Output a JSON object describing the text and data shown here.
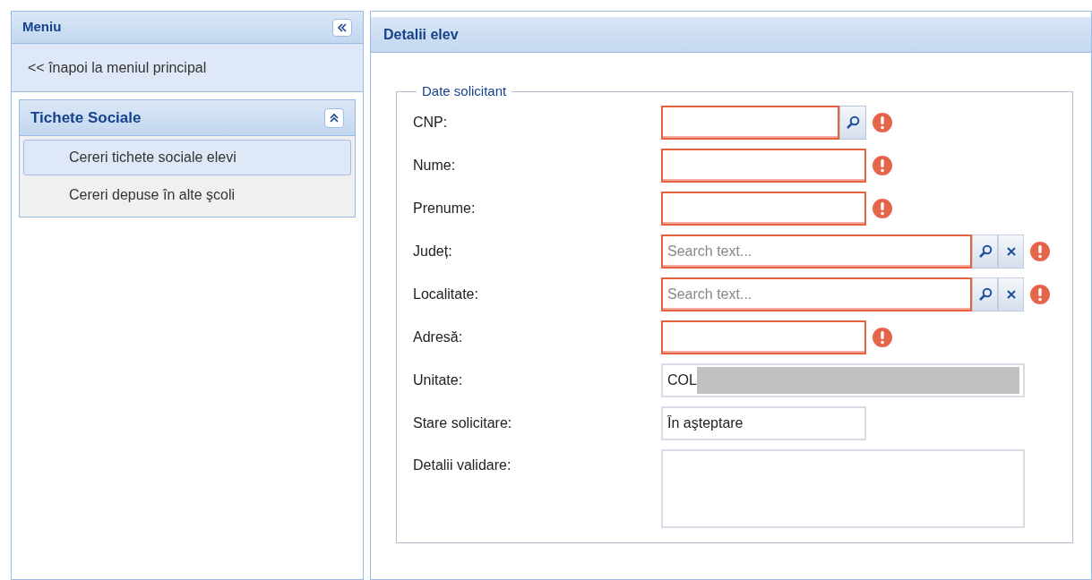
{
  "sidebar": {
    "title": "Meniu",
    "back_link": "<< înapoi la meniul principal",
    "section": {
      "title": "Tichete Sociale",
      "expanded": true,
      "items": [
        {
          "label": "Cereri tichete sociale elevi",
          "selected": true
        },
        {
          "label": "Cereri depuse în alte şcoli",
          "selected": false
        }
      ]
    }
  },
  "main": {
    "title": "Detalii elev",
    "fieldset": {
      "legend": "Date solicitant",
      "fields": [
        {
          "label": "CNP:",
          "kind": "lookup",
          "invalid": true
        },
        {
          "label": "Nume:",
          "kind": "text",
          "invalid": true
        },
        {
          "label": "Prenume:",
          "kind": "text",
          "invalid": true
        },
        {
          "label": "Județ:",
          "kind": "combo",
          "placeholder": "Search text...",
          "invalid": true
        },
        {
          "label": "Localitate:",
          "kind": "combo",
          "placeholder": "Search text...",
          "invalid": true
        },
        {
          "label": "Adresă:",
          "kind": "text",
          "invalid": true
        },
        {
          "label": "Unitate:",
          "kind": "redacted",
          "value": "COL",
          "invalid": false
        },
        {
          "label": "Stare solicitare:",
          "kind": "readonly",
          "value": "În aşteptare",
          "invalid": false
        },
        {
          "label": "Detalii validare:",
          "kind": "textarea",
          "invalid": false
        }
      ]
    }
  }
}
